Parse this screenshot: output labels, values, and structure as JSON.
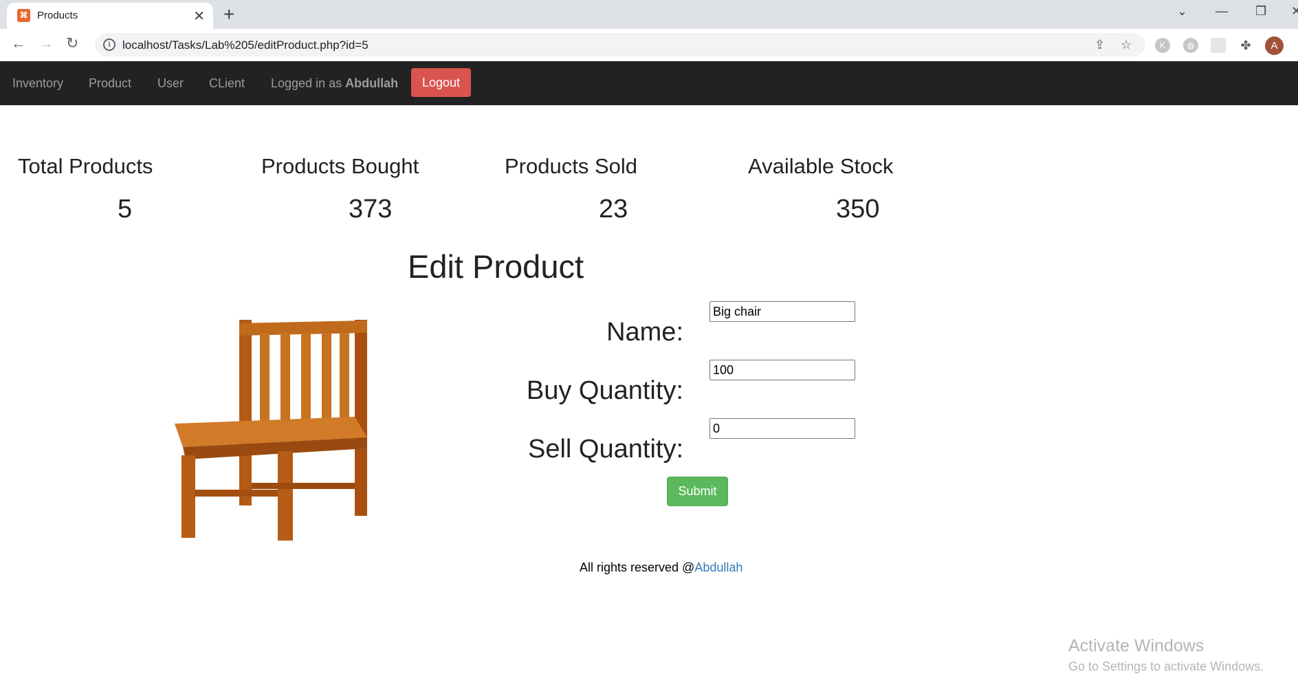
{
  "browser": {
    "tab_title": "Products",
    "favicon_glyph": "⌘",
    "url": "localhost/Tasks/Lab%205/editProduct.php?id=5",
    "avatar_letter": "A",
    "ext_k_letter": "K"
  },
  "navbar": {
    "items": [
      "Inventory",
      "Product",
      "User",
      "CLient"
    ],
    "logged_in_prefix": "Logged in as",
    "username": "Abdullah",
    "logout_label": "Logout",
    "bg_color": "#222222",
    "logout_color": "#d9534f"
  },
  "stats": [
    {
      "label": "Total Products",
      "value": "5"
    },
    {
      "label": "Products Bought",
      "value": "373"
    },
    {
      "label": "Products Sold",
      "value": "23"
    },
    {
      "label": "Available Stock",
      "value": "350"
    }
  ],
  "edit": {
    "title": "Edit Product",
    "fields": [
      {
        "label": "Name:",
        "value": "Big chair"
      },
      {
        "label": "Buy Quantity:",
        "value": "100"
      },
      {
        "label": "Sell Quantity:",
        "value": "0"
      }
    ],
    "submit_label": "Submit",
    "submit_color": "#5cb85c"
  },
  "footer": {
    "text": "All rights reserved @",
    "link_text": "Abdullah"
  },
  "watermark": {
    "line1": "Activate Windows",
    "line2": "Go to Settings to activate Windows."
  }
}
